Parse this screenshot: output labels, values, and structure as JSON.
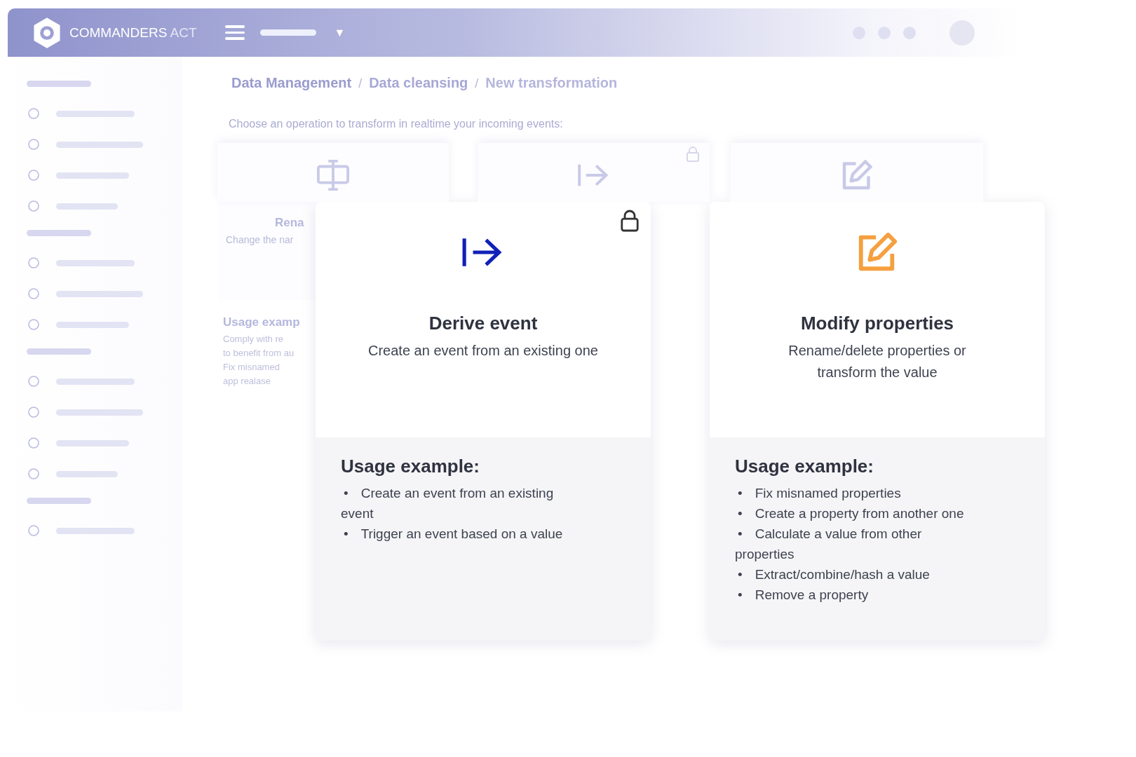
{
  "header": {
    "brand": "COMMANDERS",
    "brand_suffix": "ACT",
    "dropdown_caret": "▼"
  },
  "breadcrumb": [
    {
      "label": "Data Management"
    },
    {
      "separator": "/",
      "label": "Data cleansing"
    },
    {
      "separator": "/",
      "label": "New transformation"
    }
  ],
  "intro": "Choose an operation to transform in realtime your incoming events:",
  "background_cards": [
    {
      "kind": "rename",
      "title": "Rena",
      "subtitle": "Change the nar",
      "locked": false,
      "usage_title": "Usage examp",
      "usage_lines": [
        "Comply with re",
        "to benefit from au",
        "Fix misnamed",
        "app realase"
      ]
    },
    {
      "kind": "derive",
      "locked": true
    },
    {
      "kind": "modify",
      "locked": false
    }
  ],
  "cards": [
    {
      "kind": "derive",
      "title": "Derive event",
      "subtitle": "Create an event from an existing one",
      "locked": true,
      "usage_title": "Usage example:",
      "usage": [
        {
          "bullet": "•",
          "text": "Create an event from an existing event"
        },
        {
          "bullet": "•",
          "text": "Trigger an event based on a value"
        }
      ]
    },
    {
      "kind": "modify",
      "title": "Modify properties",
      "subtitle": "Rename/delete properties or transform the value",
      "locked": false,
      "usage_title": "Usage example:",
      "usage": [
        {
          "bullet": "•",
          "text": "Fix misnamed properties"
        },
        {
          "bullet": "•",
          "text": "Create a property from another one"
        },
        {
          "bullet": "•",
          "text": "Calculate a value from other properties"
        },
        {
          "bullet": "•",
          "text": "Extract/combine/hash a value"
        },
        {
          "bullet": "•",
          "text": "Remove a property"
        }
      ]
    }
  ]
}
